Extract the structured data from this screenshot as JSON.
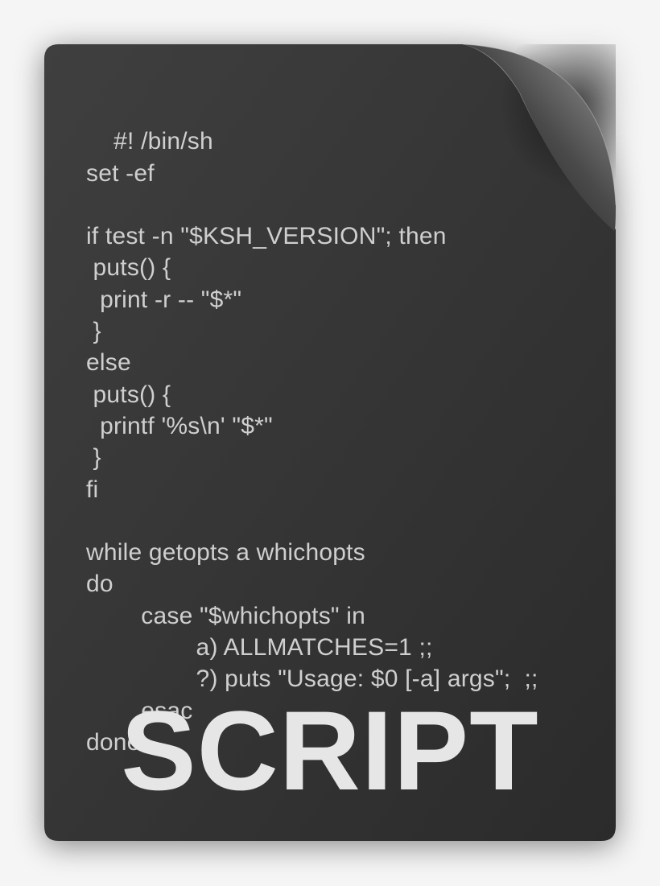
{
  "label": "SCRIPT",
  "code": {
    "lines": [
      "#! /bin/sh",
      "set -ef",
      "",
      "if test -n \"$KSH_VERSION\"; then",
      " puts() {",
      "  print -r -- \"$*\"",
      " }",
      "else",
      " puts() {",
      "  printf '%s\\n' \"$*\"",
      " }",
      "fi",
      "",
      "while getopts a whichopts",
      "do",
      "        case \"$whichopts\" in",
      "                a) ALLMATCHES=1 ;;",
      "                ?) puts \"Usage: $0 [-a] args\";  ;;",
      "        esac",
      "done"
    ]
  }
}
